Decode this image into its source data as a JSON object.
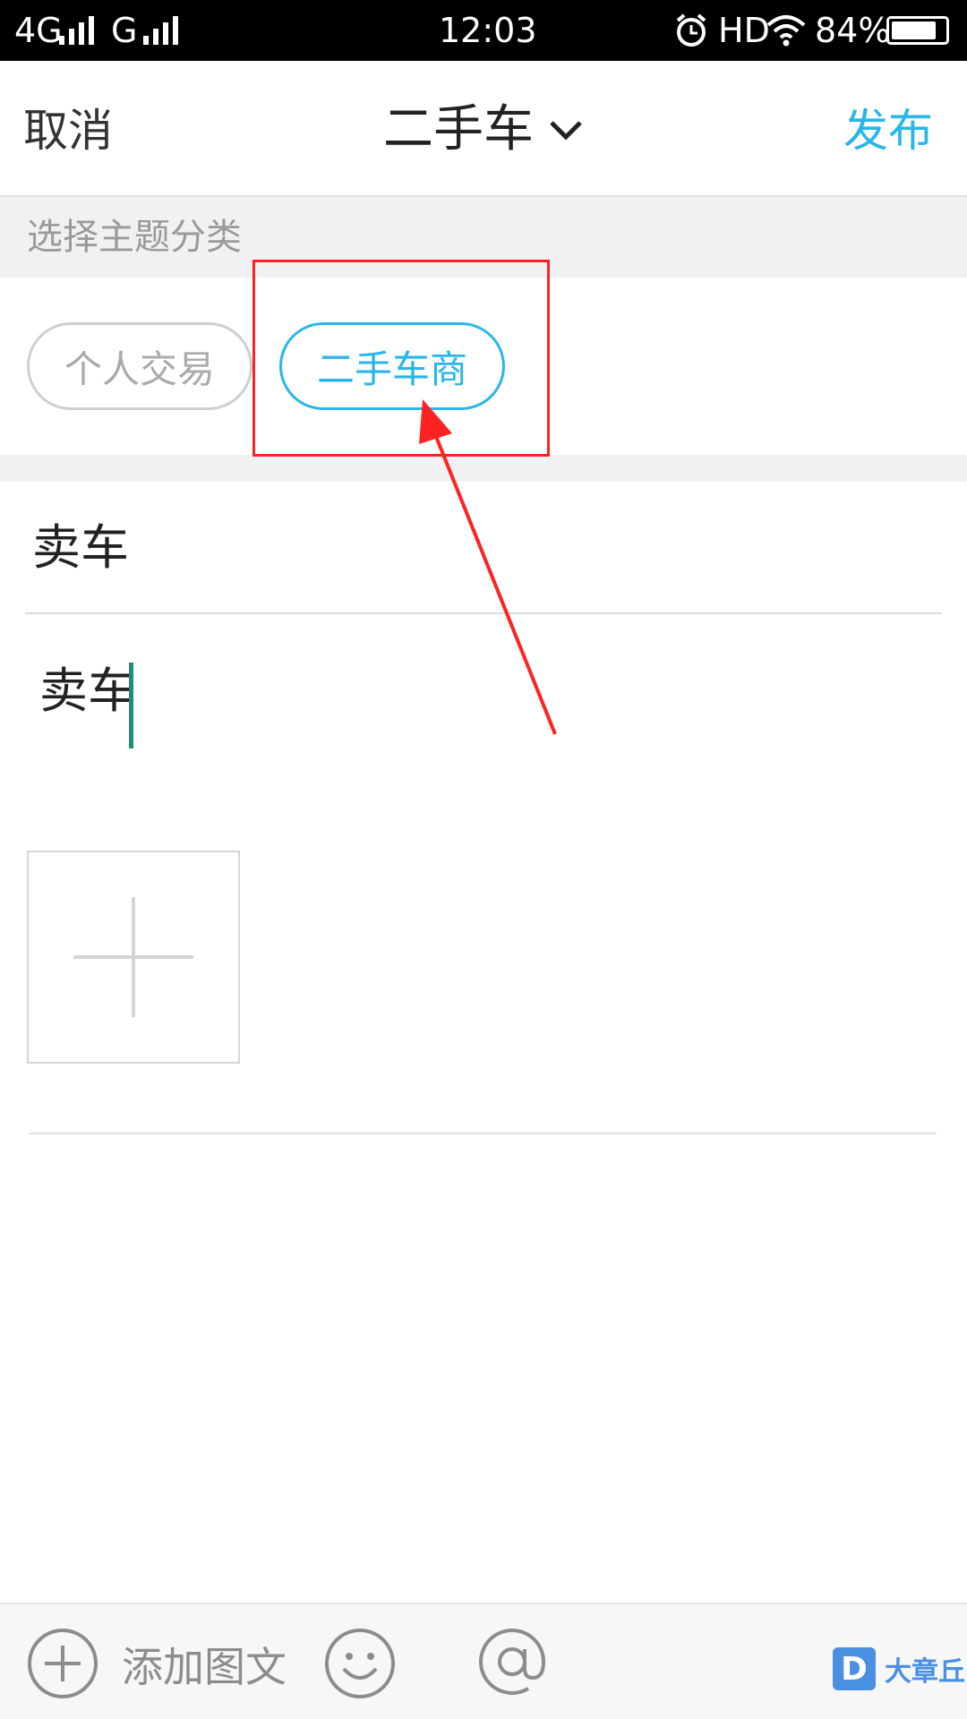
{
  "status_bar": {
    "network_1": "4G",
    "network_2": "G",
    "time": "12:03",
    "hd": "HD",
    "battery_percent": "84%",
    "battery_level": 0.84
  },
  "top_bar": {
    "cancel_label": "取消",
    "title": "二手车",
    "publish_label": "发布"
  },
  "category": {
    "header": "选择主题分类",
    "options": [
      "个人交易",
      "二手车商"
    ],
    "selected": "二手车商"
  },
  "form": {
    "title_value": "卖车",
    "content_value": "卖车"
  },
  "toolbar": {
    "add_label": "添加图文"
  },
  "watermark": {
    "badge": "D",
    "text": "大章丘"
  },
  "colors": {
    "accent": "#29b6e8",
    "annotation": "#ff2222",
    "caret": "#1f8f74"
  }
}
